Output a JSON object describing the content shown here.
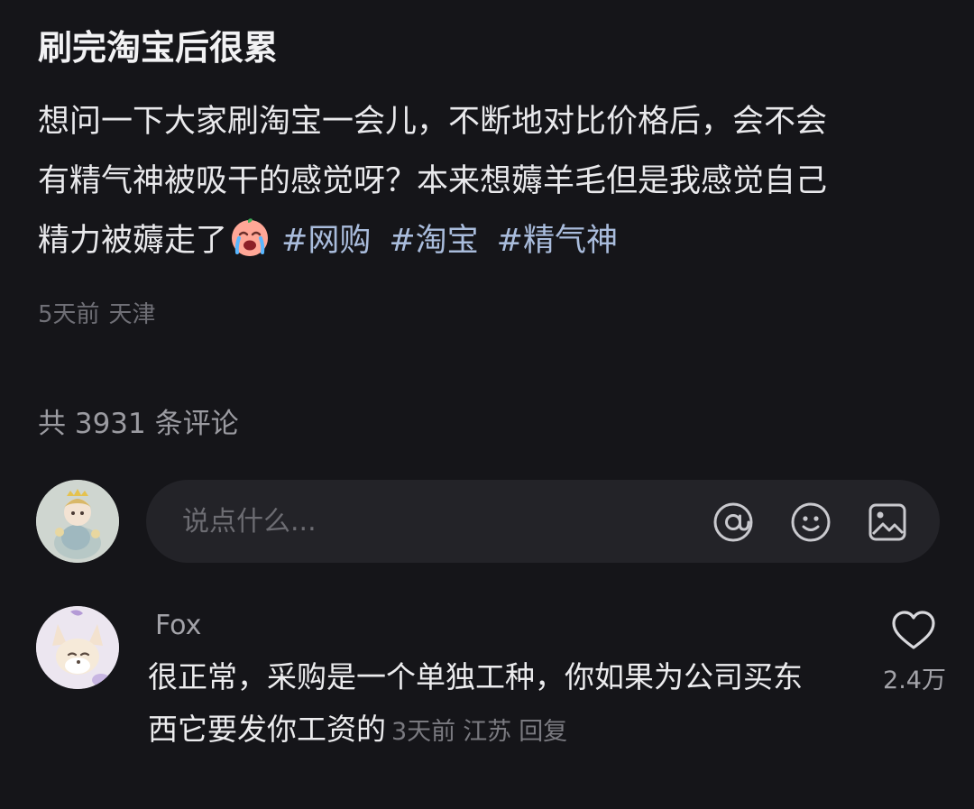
{
  "post": {
    "title": "刷完淘宝后很累",
    "body_lines": [
      "想问一下大家刷淘宝一会儿，不断地对比价格后，会不会",
      "有精气神被吸干的感觉呀？本来想薅羊毛但是我感觉自己",
      "精力被薅走了"
    ],
    "emoji": "crying-face-emoji",
    "hashtags": [
      "#网购",
      "#淘宝",
      "#精气神"
    ],
    "time": "5天前",
    "location": "天津"
  },
  "comments_header": {
    "count_text": "共 3931 条评论"
  },
  "composer": {
    "placeholder": "说点什么...",
    "icons": [
      "at-icon",
      "emoji-icon",
      "image-icon"
    ]
  },
  "comments": [
    {
      "username": "Fox",
      "text_lines": [
        "很正常，采购是一个单独工种，你如果为公司买东",
        "西它要发你工资的"
      ],
      "time": "3天前",
      "location": "江苏",
      "reply_label": "回复",
      "likes": "2.4万"
    }
  ],
  "colors": {
    "background": "#151519",
    "hashtag": "#a9bcdc",
    "composer_bg": "#232328"
  }
}
